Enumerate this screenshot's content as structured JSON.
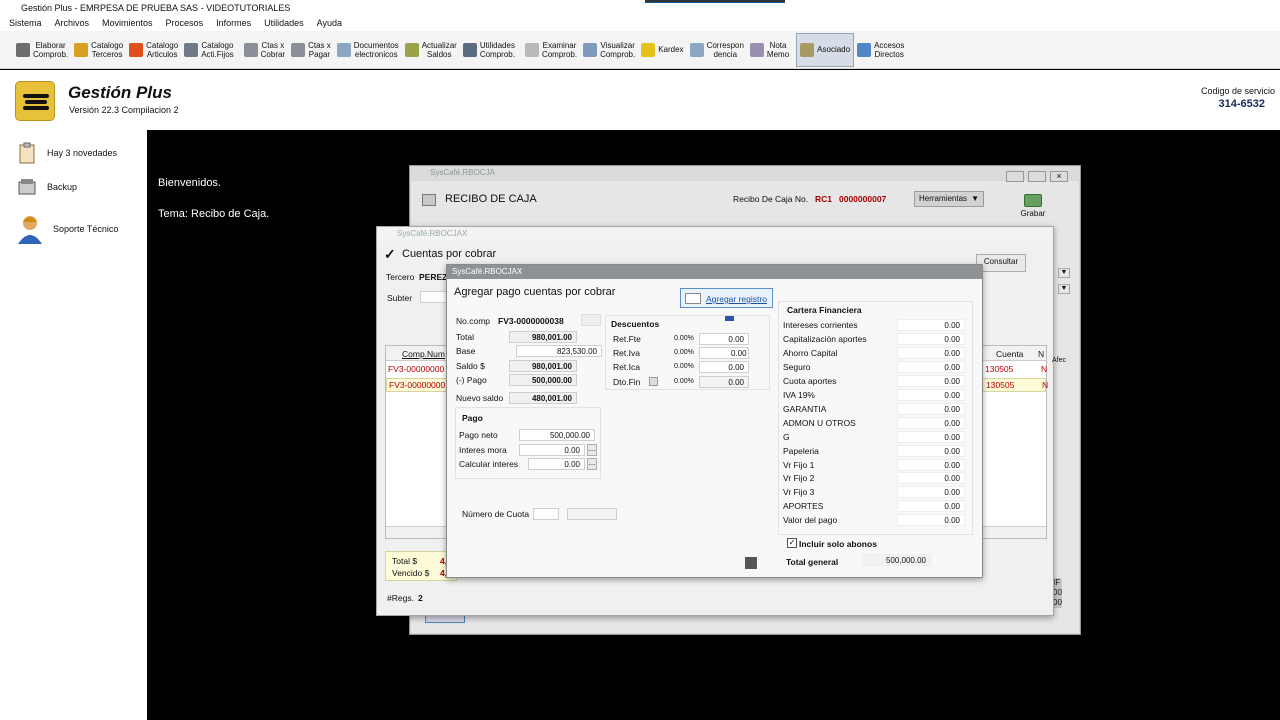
{
  "app": {
    "title": "Gestión Plus - EMRPESA DE PRUEBA SAS - VIDEOTUTORIALES"
  },
  "menu": [
    "Sistema",
    "Archivos",
    "Movimientos",
    "Procesos",
    "Informes",
    "Utilidades",
    "Ayuda"
  ],
  "toolbar": [
    {
      "label": "Elaborar\nComprob.",
      "icon": "edit-document-icon",
      "color": "#6d6d6d"
    },
    {
      "label": "Catalogo\nTerceros",
      "icon": "person-icon",
      "color": "#d8a020"
    },
    {
      "label": "Catalogo\nArticulos",
      "icon": "box-icon",
      "color": "#e0501e"
    },
    {
      "label": "Catalogo\nActi.Fijos",
      "icon": "tools-icon",
      "color": "#707a86"
    },
    {
      "label": "Ctas x\nCobrar",
      "icon": "receivable-icon",
      "color": "#8a8f98"
    },
    {
      "label": "Ctas x\nPagar",
      "icon": "payable-icon",
      "color": "#8a8f98"
    },
    {
      "label": "Documentos\nelectronicos",
      "icon": "documents-icon",
      "color": "#8ba7c2"
    },
    {
      "label": "Actualizar\nSaldos",
      "icon": "refresh-gear-icon",
      "color": "#9aa34a"
    },
    {
      "label": "Utilidades\nComprob.",
      "icon": "utilities-icon",
      "color": "#5b6c82"
    },
    {
      "label": "Examinar\nComprob.",
      "icon": "examine-icon",
      "color": "#b9b9b9"
    },
    {
      "label": "Visualizar\nComprob.",
      "icon": "magnifier-icon",
      "color": "#7c9bbd"
    },
    {
      "label": "Kardex",
      "icon": "kardex-icon",
      "color": "#e2c21b"
    },
    {
      "label": "Correspon\ndencia",
      "icon": "mail-icon",
      "color": "#8ba7c2"
    },
    {
      "label": "Nota\nMemo",
      "icon": "note-icon",
      "color": "#9a8fb0"
    },
    {
      "label": "Asociado",
      "icon": "associate-icon",
      "color": "#a79a63"
    },
    {
      "label": "Accesos\nDirectos",
      "icon": "folder-icon",
      "color": "#4f86c6"
    }
  ],
  "header": {
    "brand": "Gestión Plus",
    "version": "Versión 22.3  Compilacion 2",
    "service_label": "Codigo de servicio",
    "service_number": "314-6532"
  },
  "sidebar": [
    {
      "label": "Hay 3 novedades",
      "icon": "clipboard-icon"
    },
    {
      "label": "Backup",
      "icon": "backup-icon"
    },
    {
      "label": "Soporte Técnico",
      "icon": "support-agent-icon"
    }
  ],
  "main": {
    "welcome": "Bienvenidos.",
    "tema": "Tema: Recibo de Caja."
  },
  "recibo": {
    "window_title": "SysCafé.RBOCJA",
    "title": "RECIBO DE CAJA",
    "number_label": "Recibo De Caja  No.",
    "doc_type": "RC1",
    "doc_number": "0000000007",
    "tools_label": "Herramientas",
    "save_label": "Grabar"
  },
  "cxc": {
    "window_title": "SysCafé.RBOCJAX",
    "title": "Cuentas por cobrar",
    "tercero_label": "Tercero",
    "tercero_value": "PEREZ",
    "subter_label": "Subter",
    "consultar_label": "Consultar",
    "col_comp": "Comp.Num",
    "col_cuenta": "Cuenta",
    "col_n": "N",
    "col_afec": "Afec",
    "rows": [
      {
        "comp": "FV3-00000000",
        "cuenta": "130505",
        "n": "N"
      },
      {
        "comp": "FV3-00000000",
        "cuenta": "130505",
        "n": "N"
      }
    ],
    "total_label": "Total $",
    "total_value": "4,",
    "vencido_label": "Vencido $",
    "vencido_value": "4,",
    "regs_label": "#Regs.",
    "regs_value": "2"
  },
  "dialog": {
    "window_title": "SysCafé.RBOCJAX",
    "title": "Agregar pago cuentas por cobrar",
    "add_button": "Agregar registro",
    "nocomp_label": "No.comp",
    "nocomp_value": "FV3-0000000038",
    "total_label": "Total",
    "total_value": "980,001.00",
    "base_label": "Base",
    "base_value": "823,530.00",
    "saldo_label": "Saldo $",
    "saldo_value": "980,001.00",
    "pago_label": "(-) Pago",
    "pago_value": "500,000.00",
    "nuevo_label": "Nuevo saldo",
    "nuevo_value": "480,001.00",
    "descuentos_title": "Descuentos",
    "descuentos": [
      {
        "label": "Ret.Fte",
        "pct": "0.00%",
        "value": "0.00"
      },
      {
        "label": "Ret.Iva",
        "pct": "0.00%",
        "value": "0.00"
      },
      {
        "label": "Ret.Ica",
        "pct": "0.00%",
        "value": "0.00"
      },
      {
        "label": "Dto.Fin",
        "pct": "0.00%",
        "value": "0.00"
      }
    ],
    "pago_title": "Pago",
    "pago_neto_label": "Pago neto",
    "pago_neto_value": "500,000.00",
    "interes_label": "Interes mora",
    "interes_value": "0.00",
    "calcular_label": "Calcular interes",
    "calcular_value": "0.00",
    "cuota_label": "Número de Cuota",
    "cartera_title": "Cartera Financiera",
    "cartera": [
      {
        "label": "Intereses corrientes",
        "value": "0.00"
      },
      {
        "label": "Capitalización aportes",
        "value": "0.00"
      },
      {
        "label": "Ahorro Capital",
        "value": "0.00"
      },
      {
        "label": "Seguro",
        "value": "0.00"
      },
      {
        "label": "Cuota aportes",
        "value": "0.00"
      },
      {
        "label": "IVA 19%",
        "value": "0.00"
      },
      {
        "label": "GARANTIA",
        "value": "0.00"
      },
      {
        "label": "ADMON U OTROS",
        "value": "0.00"
      },
      {
        "label": "G",
        "value": "0.00"
      },
      {
        "label": "Papeleria",
        "value": "0.00"
      },
      {
        "label": "Vr Fijo 1",
        "value": "0.00"
      },
      {
        "label": "Vr Fijo 2",
        "value": "0.00"
      },
      {
        "label": "Vr Fijo 3",
        "value": "0.00"
      },
      {
        "label": "APORTES",
        "value": "0.00"
      },
      {
        "label": "Valor del pago",
        "value": "0.00"
      }
    ],
    "solo_abonos_label": "Incluir solo abonos",
    "total_general_label": "Total general",
    "total_general_value": "500,000.00"
  }
}
